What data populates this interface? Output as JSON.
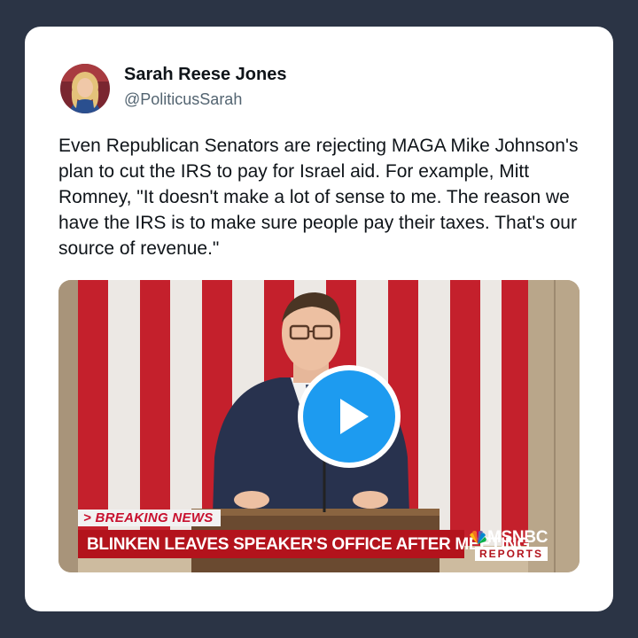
{
  "tweet": {
    "author_name": "Sarah Reese Jones",
    "author_handle": "@PoliticusSarah",
    "text": "Even Republican Senators are rejecting MAGA Mike Johnson's plan to cut the IRS to pay for Israel aid. For example, Mitt Romney, \"It doesn't make a lot of sense to me. The reason we have the IRS is to make sure people pay their taxes. That's our source of revenue.\""
  },
  "video": {
    "play_icon": "play-icon",
    "chyron_label": "> BREAKING NEWS",
    "chyron_headline": "BLINKEN LEAVES SPEAKER'S OFFICE AFTER MEETING",
    "network": "MSNBC",
    "network_sub": "REPORTS"
  },
  "colors": {
    "background": "#2b3445",
    "play_button": "#1d9bf0",
    "chyron_red": "#b3131c"
  }
}
